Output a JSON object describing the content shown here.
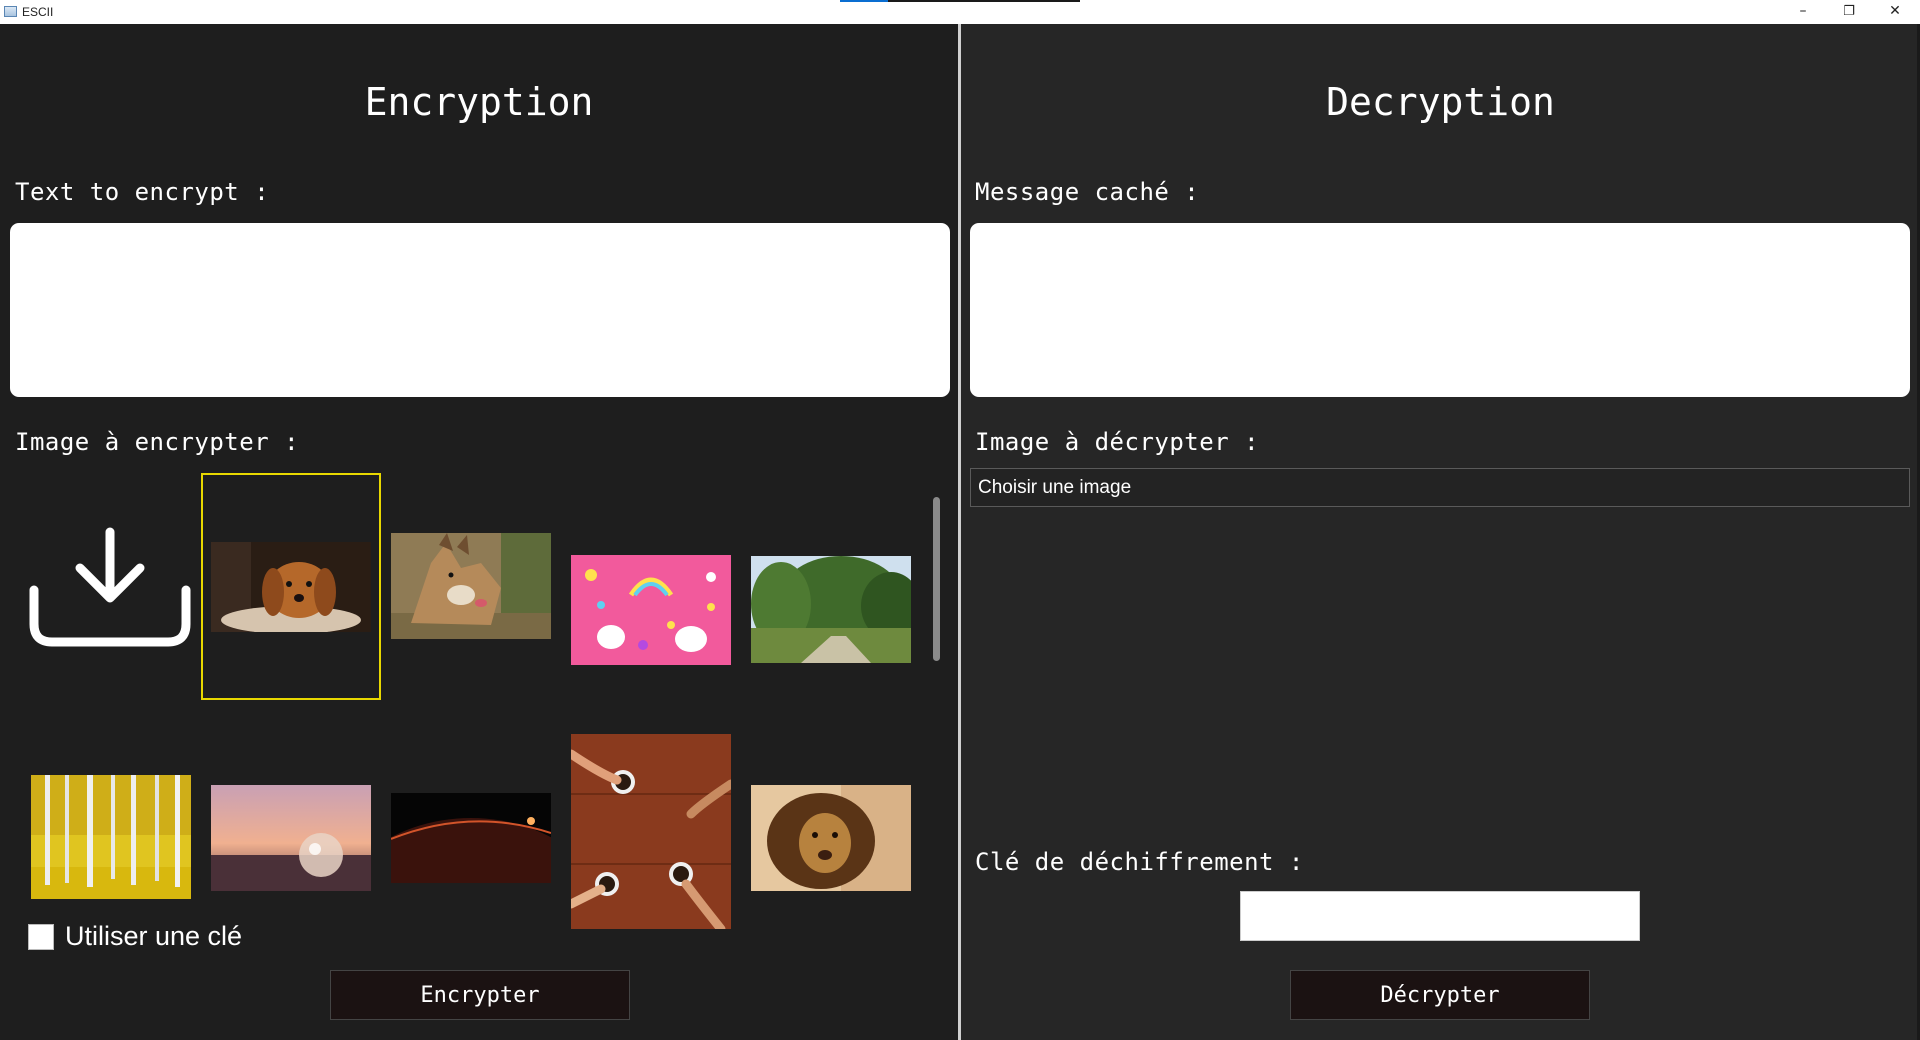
{
  "window": {
    "title": "ESCII",
    "controls": {
      "minimize": "–",
      "maximize": "❐",
      "close": "✕"
    }
  },
  "encryption": {
    "heading": "Encryption",
    "text_label": "Text to encrypt :",
    "text_value": "",
    "image_label": "Image à encrypter :",
    "thumbnails": [
      {
        "name": "upload-icon",
        "kind": "upload"
      },
      {
        "name": "dachshund-puppy",
        "kind": "image",
        "selected": true
      },
      {
        "name": "wolf-dog",
        "kind": "image"
      },
      {
        "name": "unicorn-pattern",
        "kind": "image"
      },
      {
        "name": "forest-path",
        "kind": "image"
      },
      {
        "name": "birch-forest",
        "kind": "image"
      },
      {
        "name": "crystal-ball-sunset",
        "kind": "image"
      },
      {
        "name": "planet-horizon",
        "kind": "image"
      },
      {
        "name": "coffee-table",
        "kind": "image"
      },
      {
        "name": "lion",
        "kind": "image"
      }
    ],
    "use_key_label": "Utiliser une clé",
    "use_key_checked": false,
    "button_label": "Encrypter"
  },
  "decryption": {
    "heading": "Decryption",
    "message_label": "Message caché :",
    "message_value": "",
    "image_label": "Image à décrypter :",
    "image_select_value": "Choisir une image",
    "key_label": "Clé de déchiffrement :",
    "key_value": "",
    "button_label": "Décrypter"
  },
  "colors": {
    "left_panel": "#1e1e1e",
    "right_panel": "#262626",
    "selection_border": "#e8d800",
    "button_bg": "#1b1212"
  }
}
